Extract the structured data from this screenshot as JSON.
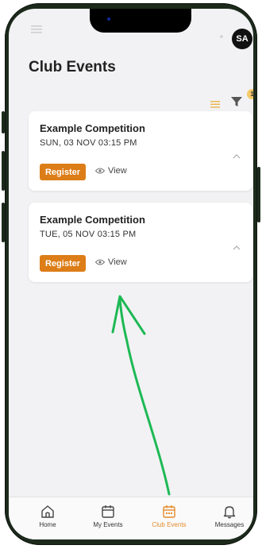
{
  "header": {
    "avatar_initials": "SA",
    "title": "Club Events",
    "filter_count": "1"
  },
  "events": [
    {
      "title": "Example Competition",
      "date": "SUN, 03 NOV 03:15 PM",
      "register_label": "Register",
      "view_label": "View"
    },
    {
      "title": "Example Competition",
      "date": "TUE, 05 NOV 03:15 PM",
      "register_label": "Register",
      "view_label": "View"
    }
  ],
  "tabs": [
    {
      "label": "Home",
      "icon": "home-icon"
    },
    {
      "label": "My Events",
      "icon": "calendar-icon"
    },
    {
      "label": "Club Events",
      "icon": "calendar-icon",
      "active": true
    },
    {
      "label": "Messages",
      "icon": "bell-icon"
    }
  ],
  "colors": {
    "accent": "#dc7d17",
    "active_tab": "#e58a2a",
    "annotation_arrow": "#1db954"
  }
}
